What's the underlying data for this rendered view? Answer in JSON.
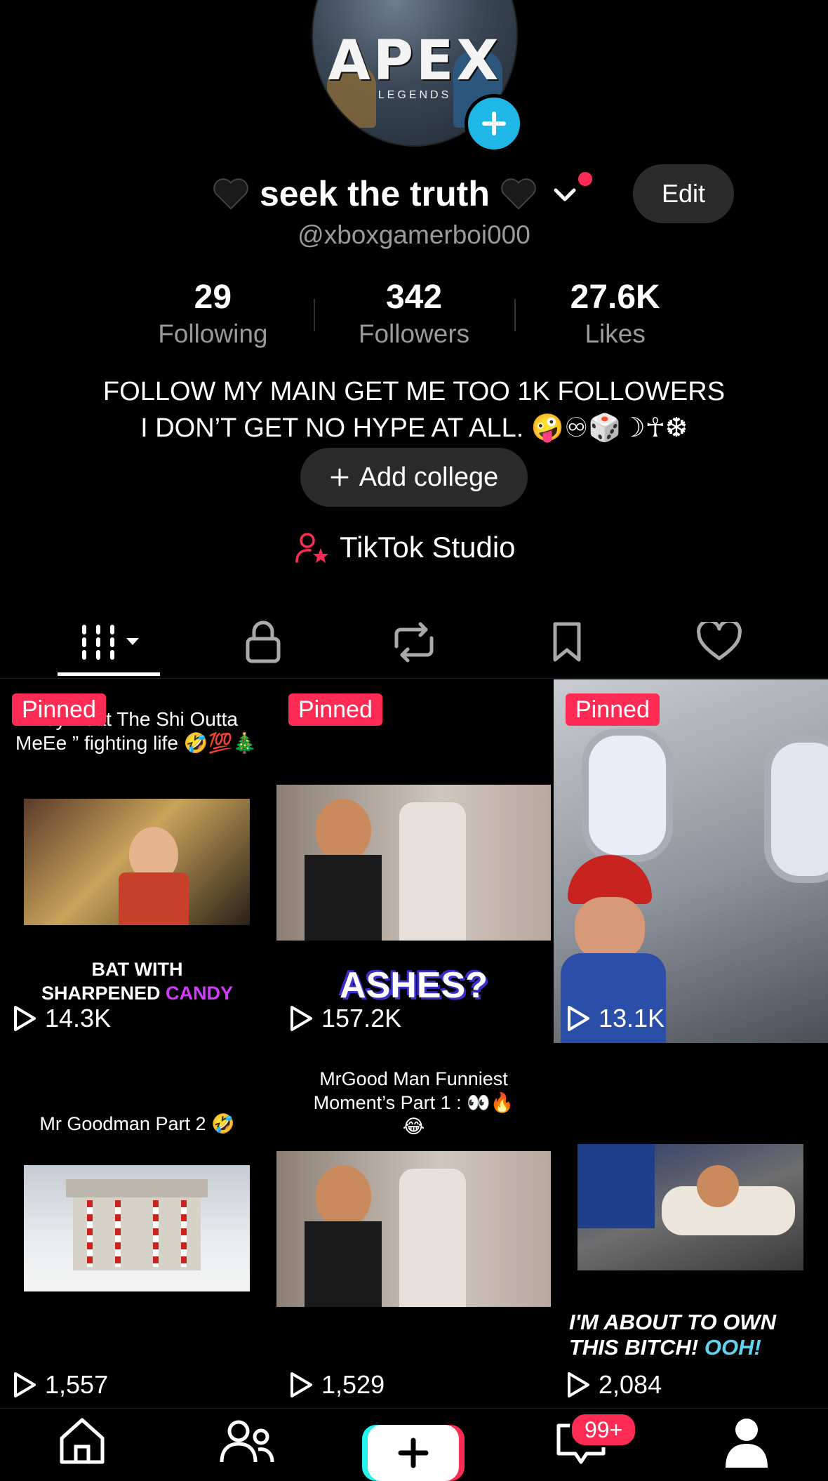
{
  "profile": {
    "display_name": "seek the truth",
    "handle": "@xboxgamerboi000",
    "edit_label": "Edit",
    "avatar_text": "APEX",
    "avatar_subtext": "LEGENDS"
  },
  "stats": [
    {
      "value": "29",
      "label": "Following"
    },
    {
      "value": "342",
      "label": "Followers"
    },
    {
      "value": "27.6K",
      "label": "Likes"
    }
  ],
  "bio": {
    "line1": "FOLLOW MY MAIN GET ME TOO 1K FOLLOWERS",
    "line2": "I DON’T GET NO HYPE AT ALL. 🤪♾🎲☽☥❆"
  },
  "college_button": {
    "label": "Add college"
  },
  "studio": {
    "label": "TikTok Studio"
  },
  "tabs": [
    {
      "icon": "grid-icon",
      "active": true
    },
    {
      "icon": "lock-icon"
    },
    {
      "icon": "repost-icon"
    },
    {
      "icon": "bookmark-icon"
    },
    {
      "icon": "heart-icon"
    }
  ],
  "videos": [
    {
      "pinned_label": "Pinned",
      "caption": "“They Beat The Shi Outta MeEe ” fighting life 🤣💯🎄",
      "overlay": "BAT WITH SHARPENED CANDY",
      "views": "14.3K"
    },
    {
      "pinned_label": "Pinned",
      "caption": "",
      "overlay": "ASHES?",
      "views": "157.2K"
    },
    {
      "pinned_label": "Pinned",
      "caption": "",
      "overlay": "",
      "views": "13.1K"
    },
    {
      "caption": "Mr Goodman Part 2 🤣",
      "overlay": "",
      "views": "1,557"
    },
    {
      "caption": "MrGood Man Funniest Moment’s Part 1 : 👀🔥😂",
      "overlay": "",
      "views": "1,529"
    },
    {
      "caption": "",
      "overlay": "I'M ABOUT TO OWN THIS BITCH! OOH!",
      "views": "2,084"
    }
  ],
  "nav": {
    "inbox_badge": "99+"
  },
  "colors": {
    "accent": "#fe2c55",
    "cyan": "#25f4ee",
    "avatar_add": "#1fb7e6",
    "pill": "#2b2b2b"
  }
}
